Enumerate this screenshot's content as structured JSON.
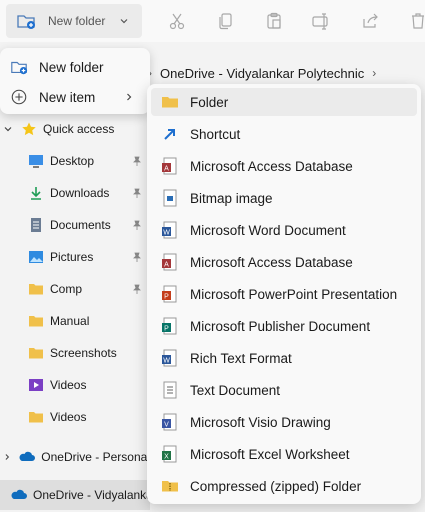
{
  "toolbar": {
    "new_label": "New folder",
    "icons": [
      "cut-icon",
      "copy-icon",
      "paste-icon",
      "rename-icon",
      "share-icon",
      "delete-icon"
    ]
  },
  "address": {
    "crumbs": [
      "OneDrive - Vidyalankar Polytechnic"
    ]
  },
  "new_menu": {
    "items": [
      {
        "label": "New folder",
        "icon": "new-folder-icon"
      },
      {
        "label": "New item",
        "icon": "new-item-icon"
      }
    ]
  },
  "sidebar": {
    "quick_access": "Quick access",
    "items": [
      {
        "label": "Desktop",
        "icon": "desktop-icon",
        "pinned": true
      },
      {
        "label": "Downloads",
        "icon": "downloads-icon",
        "pinned": true
      },
      {
        "label": "Documents",
        "icon": "documents-icon",
        "pinned": true
      },
      {
        "label": "Pictures",
        "icon": "pictures-icon",
        "pinned": true
      },
      {
        "label": "Comp",
        "icon": "folder-icon",
        "pinned": true
      },
      {
        "label": "Manual",
        "icon": "folder-icon",
        "pinned": false
      },
      {
        "label": "Screenshots",
        "icon": "folder-icon",
        "pinned": false
      },
      {
        "label": "Videos",
        "icon": "videos-icon",
        "pinned": false
      },
      {
        "label": "Videos",
        "icon": "folder-icon",
        "pinned": false
      }
    ],
    "onedrive_personal": "OneDrive - Personal",
    "onedrive_vidyalankar": "OneDrive - Vidyalankar"
  },
  "submenu": {
    "items": [
      {
        "label": "Folder",
        "icon": "folder-icon",
        "color": "#f0c04a"
      },
      {
        "label": "Shortcut",
        "icon": "shortcut-icon",
        "color": "#1e6fcf"
      },
      {
        "label": "Microsoft Access Database",
        "icon": "access-icon",
        "color": "#a4373a"
      },
      {
        "label": "Bitmap image",
        "icon": "bitmap-icon",
        "color": "#2a6db5"
      },
      {
        "label": "Microsoft Word Document",
        "icon": "word-icon",
        "color": "#2b579a"
      },
      {
        "label": "Microsoft Access Database",
        "icon": "access-icon",
        "color": "#a4373a"
      },
      {
        "label": "Microsoft PowerPoint Presentation",
        "icon": "powerpoint-icon",
        "color": "#c43e1c"
      },
      {
        "label": "Microsoft Publisher Document",
        "icon": "publisher-icon",
        "color": "#077568"
      },
      {
        "label": "Rich Text Format",
        "icon": "rtf-icon",
        "color": "#2b579a"
      },
      {
        "label": "Text Document",
        "icon": "text-icon",
        "color": "#666666"
      },
      {
        "label": "Microsoft Visio Drawing",
        "icon": "visio-icon",
        "color": "#3955a3"
      },
      {
        "label": "Microsoft Excel Worksheet",
        "icon": "excel-icon",
        "color": "#217346"
      },
      {
        "label": "Compressed (zipped) Folder",
        "icon": "zip-icon",
        "color": "#f0c04a"
      }
    ]
  }
}
